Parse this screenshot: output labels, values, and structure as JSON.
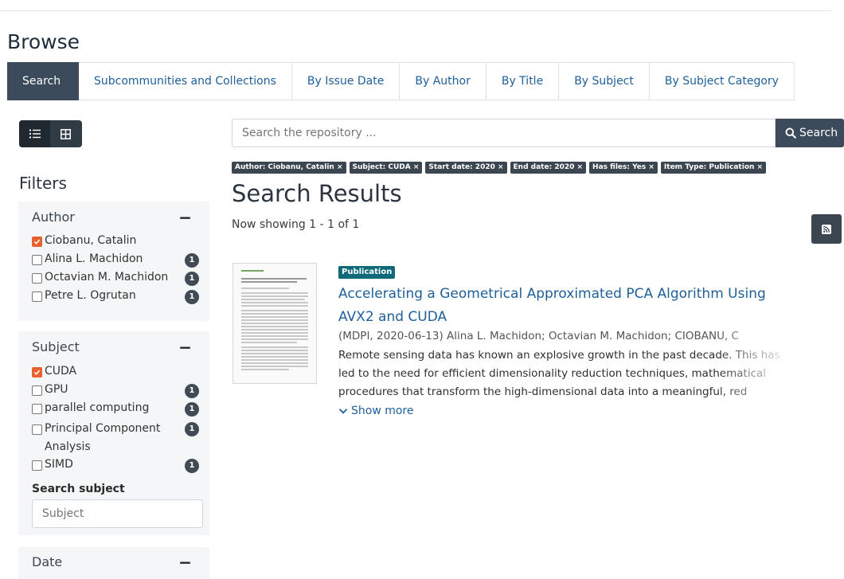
{
  "page": {
    "title": "Browse"
  },
  "tabs": [
    {
      "label": "Search"
    },
    {
      "label": "Subcommunities and Collections"
    },
    {
      "label": "By Issue Date"
    },
    {
      "label": "By Author"
    },
    {
      "label": "By Title"
    },
    {
      "label": "By Subject"
    },
    {
      "label": "By Subject Category"
    }
  ],
  "view_toggle": {
    "options": [
      "list-icon",
      "grid-icon"
    ],
    "selected": "list"
  },
  "filters": {
    "title": "Filters",
    "author": {
      "heading": "Author",
      "collapse_label": "−",
      "items": [
        {
          "label": "Ciobanu, Catalin",
          "checked": true,
          "count": ""
        },
        {
          "label": "Alina L. Machidon",
          "checked": false,
          "count": "1"
        },
        {
          "label": "Octavian M. Machidon",
          "checked": false,
          "count": "1"
        },
        {
          "label": "Petre L. Ogrutan",
          "checked": false,
          "count": "1"
        }
      ]
    },
    "subject": {
      "heading": "Subject",
      "collapse_label": "−",
      "items": [
        {
          "label": "CUDA",
          "checked": true,
          "count": ""
        },
        {
          "label": "GPU",
          "checked": false,
          "count": "1"
        },
        {
          "label": "parallel computing",
          "checked": false,
          "count": "1"
        },
        {
          "label": "Principal Component Analysis",
          "checked": false,
          "count": "1"
        },
        {
          "label": "SIMD",
          "checked": false,
          "count": "1"
        }
      ],
      "search_label": "Search subject",
      "search_placeholder": "Subject"
    },
    "date": {
      "heading": "Date",
      "collapse_label": "−"
    }
  },
  "search": {
    "placeholder": "Search the repository ...",
    "button_label": "Search"
  },
  "active_filters": [
    "Author: Ciobanu, Catalin ×",
    "Subject: CUDA ×",
    "Start date: 2020 ×",
    "End date: 2020 ×",
    "Has files: Yes ×",
    "Item Type: Publication ×"
  ],
  "results": {
    "title": "Search Results",
    "showing": "Now showing 1 - 1 of 1",
    "items": [
      {
        "type_badge": "Publication",
        "title": "Accelerating a Geometrical Approximated PCA Algorithm Using AVX2 and CUDA",
        "meta": "(MDPI, 2020-06-13) Alina L. Machidon; Octavian M. Machidon; CIOBANU, C",
        "abstract": "Remote sensing data has known an explosive growth in the past decade. This has led to the need for efficient dimensionality reduction techniques, mathematical procedures that transform the high-dimensional data into a meaningful, red",
        "show_more": "Show more"
      }
    ]
  },
  "colors": {
    "accent": "#3b4b5b",
    "link": "#1f5f99",
    "checkbox_checked": "#e8602c",
    "badge_publication": "#0e6a78"
  }
}
